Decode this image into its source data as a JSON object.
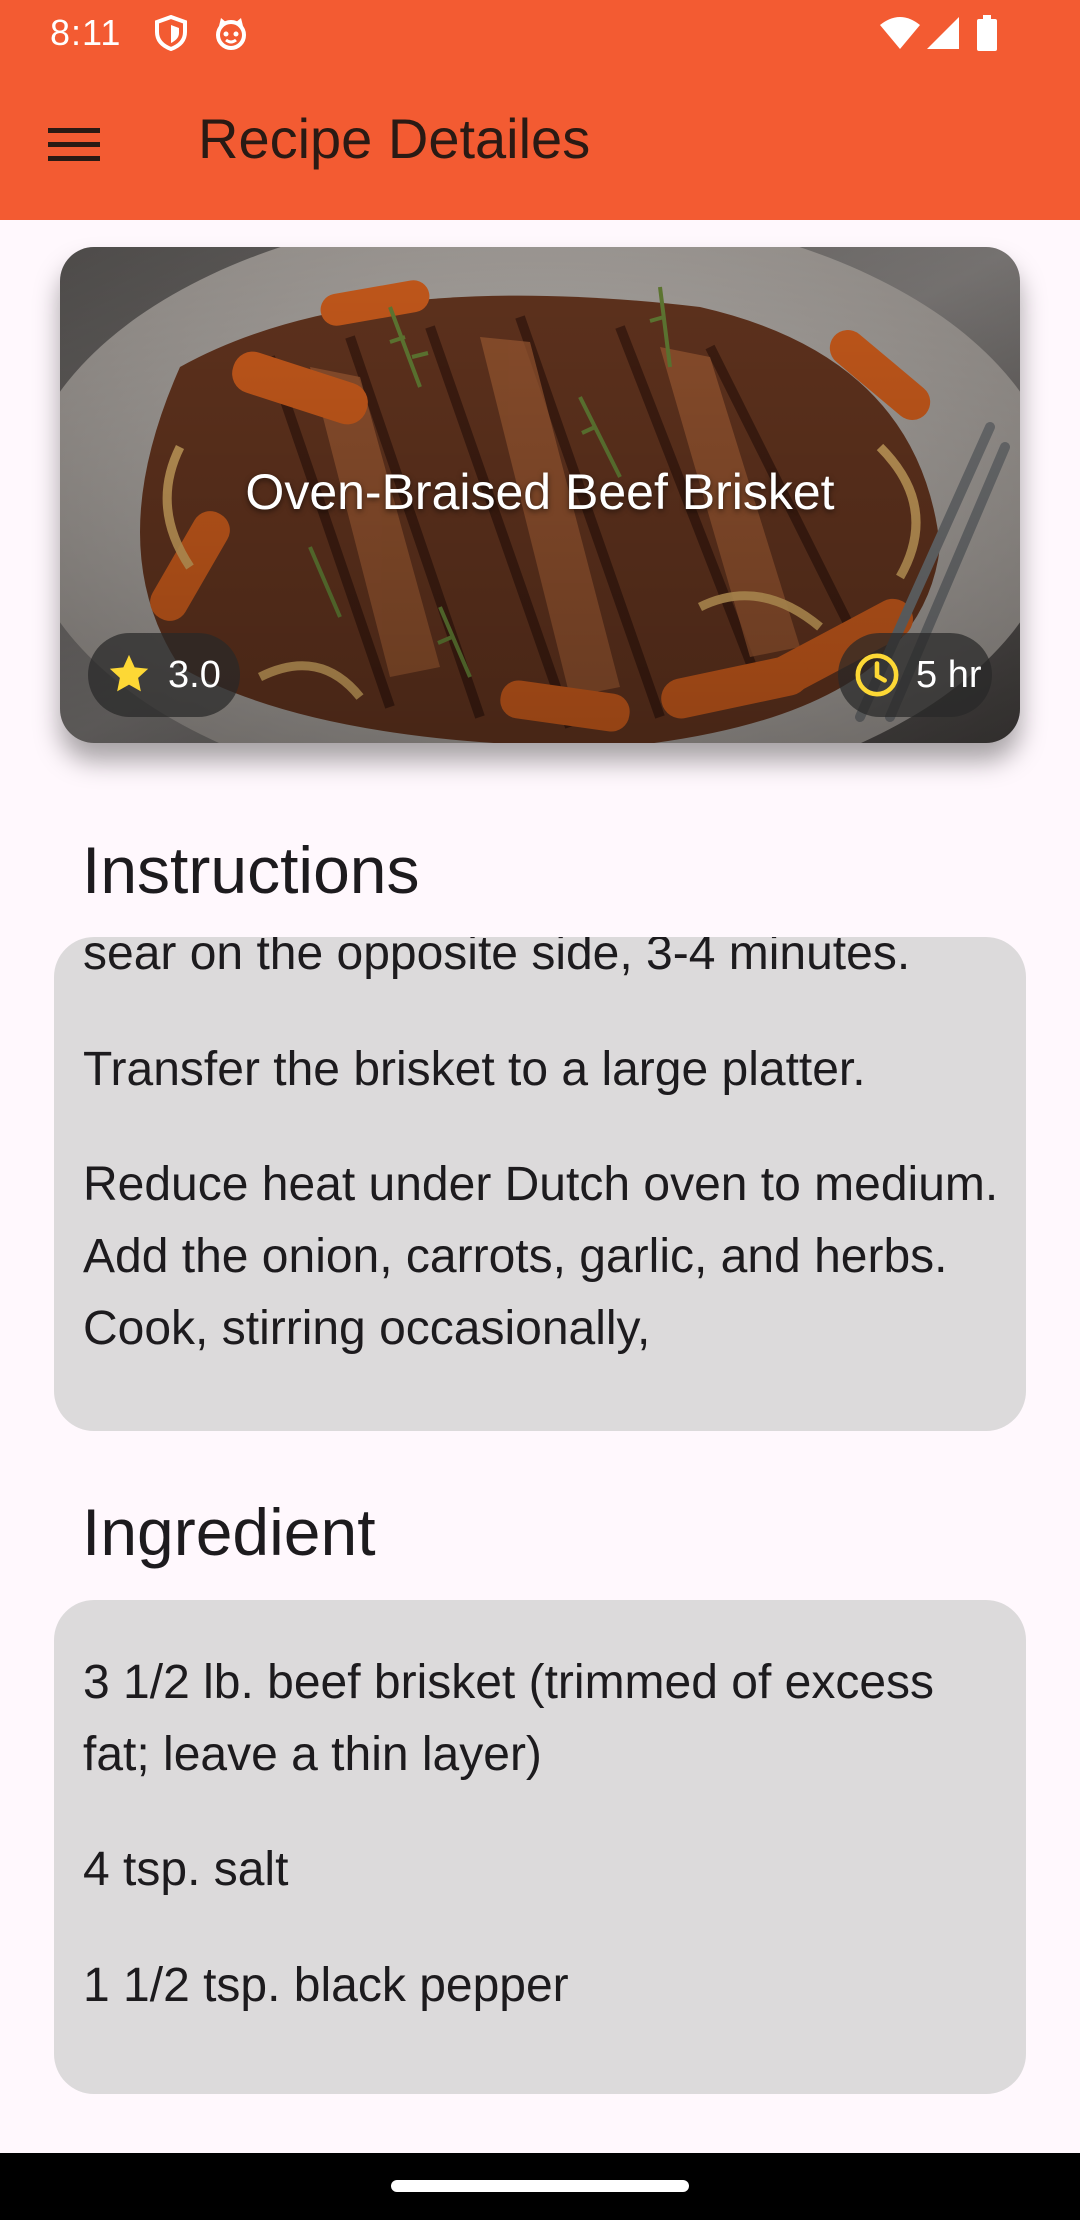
{
  "status_bar": {
    "time": "8:11",
    "icons": [
      "shield-icon",
      "cat-face-icon",
      "wifi-icon",
      "signal-icon",
      "battery-icon"
    ]
  },
  "app_bar": {
    "menu_icon": "hamburger-menu-icon",
    "title": "Recipe Detailes",
    "color": "#F35B32"
  },
  "recipe": {
    "title": "Oven-Braised Beef Brisket",
    "rating": "3.0",
    "rating_icon": "star-icon",
    "time": "5 hr",
    "time_icon": "clock-icon",
    "accent_color": "#FDD835"
  },
  "instructions": {
    "heading": "Instructions",
    "steps": [
      "sear on the opposite side, 3-4 minutes.",
      "Transfer the brisket to a large platter.",
      "Reduce heat under Dutch oven to medium. Add the onion, carrots, garlic, and herbs. Cook, stirring occasionally,"
    ]
  },
  "ingredients": {
    "heading": "Ingredient",
    "items": [
      "3 1/2 lb. beef brisket (trimmed of excess fat; leave a thin layer)",
      "4 tsp. salt",
      "1 1/2 tsp. black pepper"
    ]
  }
}
